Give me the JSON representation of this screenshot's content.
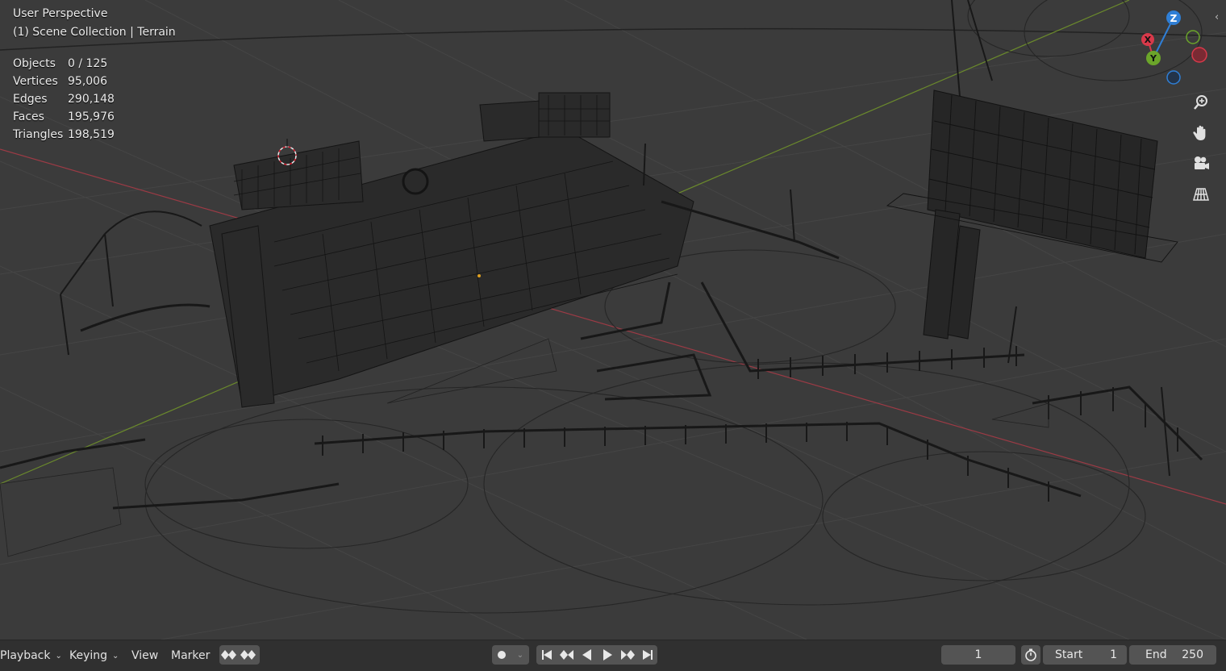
{
  "viewport": {
    "title": "User Perspective",
    "collection": "(1) Scene Collection | Terrain",
    "stats": [
      {
        "label": "Objects",
        "value": "0 / 125"
      },
      {
        "label": "Vertices",
        "value": "95,006"
      },
      {
        "label": "Edges",
        "value": "290,148"
      },
      {
        "label": "Faces",
        "value": "195,976"
      },
      {
        "label": "Triangles",
        "value": "198,519"
      }
    ],
    "gizmo": {
      "z": "Z",
      "x": "X",
      "y": "Y",
      "x_color": "#d8394a",
      "y_color": "#6ba52a",
      "z_color": "#2f7fd6"
    },
    "nav_icons": [
      "zoom-icon",
      "hand-pan-icon",
      "camera-icon",
      "grid-perspective-icon"
    ],
    "shading_mode": "wireframe"
  },
  "timeline": {
    "playback_label": "Playback",
    "keying_label": "Keying",
    "view_label": "View",
    "marker_label": "Marker",
    "current_frame": "1",
    "start_label": "Start",
    "start_value": "1",
    "end_label": "End",
    "end_value": "250"
  }
}
